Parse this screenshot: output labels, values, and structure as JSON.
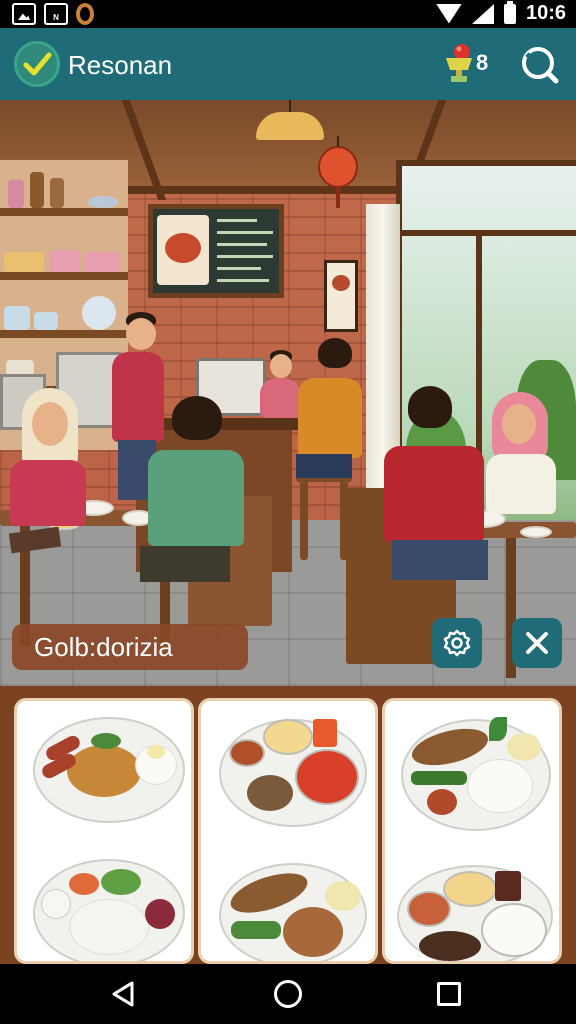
{
  "status_bar": {
    "time": "10:6",
    "left_icons": [
      "image-icon",
      "news-icon",
      "zero-icon"
    ],
    "right_icons": [
      "signal-icon",
      "wifi-icon",
      "battery-icon"
    ],
    "news_icon_text": "N"
  },
  "app_bar": {
    "title": "Resonan",
    "reward_count": "8",
    "colors": {
      "bar": "#1f6b78",
      "badge": "#2f8a7a",
      "check": "#e8e02c"
    }
  },
  "scene": {
    "description_icons": [
      "cafe-scene"
    ],
    "name_chip": "Golb:dorizia",
    "buttons": [
      "gear-icon",
      "close-icon"
    ]
  },
  "food_cards": [
    {
      "id": "card-1",
      "dishes": [
        "noodles-sausage-egg-plate",
        "rice-salad-plate"
      ]
    },
    {
      "id": "card-2",
      "dishes": [
        "soup-side-dishes-plate",
        "grilled-fish-rice-plate"
      ]
    },
    {
      "id": "card-3",
      "dishes": [
        "grilled-fish-white-rice-plate",
        "rice-bowls-set-plate"
      ]
    }
  ],
  "nav_bar": {
    "icons": [
      "back-icon",
      "home-icon",
      "recent-apps-icon"
    ]
  }
}
